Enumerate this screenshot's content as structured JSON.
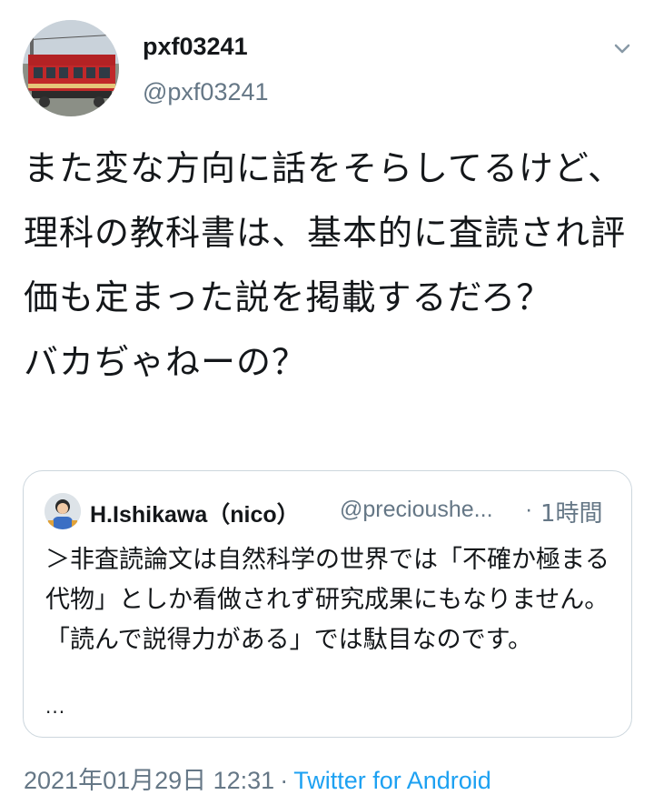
{
  "author": {
    "display_name": "pxf03241",
    "handle": "@pxf03241",
    "avatar_icon": "train-photo-avatar"
  },
  "menu": {
    "icon": "chevron-down-icon"
  },
  "tweet": {
    "text": "また変な方向に話をそらしてるけど、理科の教科書は、基本的に査読され評価も定まった説を掲載するだろ？\nバカぢゃねーの？"
  },
  "quoted_tweet": {
    "display_name": "H.Ishikawa（nico）",
    "handle": "@precioushe...",
    "separator": "·",
    "time": "1時間",
    "text": "＞非査読論文は自然科学の世界では「不確か極まる代物」としか看做されず研究成果にもなりません。「読んで説得力がある」では駄目なのです。",
    "more": "..."
  },
  "meta": {
    "timestamp": "2021年01月29日 12:31",
    "separator": "·",
    "client": "Twitter for Android"
  },
  "colors": {
    "text": "#14171a",
    "secondary": "#657786",
    "link": "#1da1f2",
    "border": "#ccd6dd"
  }
}
